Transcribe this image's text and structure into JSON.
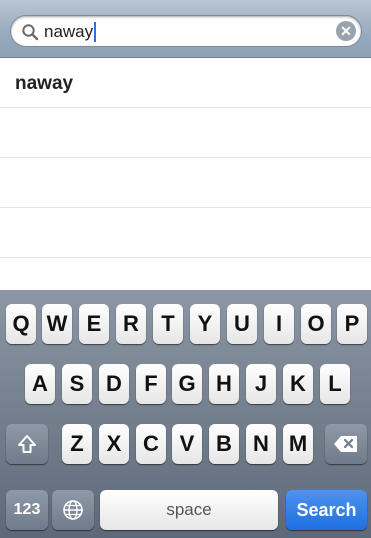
{
  "search": {
    "query": "naway"
  },
  "results": [
    {
      "label": "naway"
    },
    {
      "label": ""
    },
    {
      "label": ""
    },
    {
      "label": ""
    }
  ],
  "keyboard": {
    "row1": [
      "Q",
      "W",
      "E",
      "R",
      "T",
      "Y",
      "U",
      "I",
      "O",
      "P"
    ],
    "row2": [
      "A",
      "S",
      "D",
      "F",
      "G",
      "H",
      "J",
      "K",
      "L"
    ],
    "row3": [
      "Z",
      "X",
      "C",
      "V",
      "B",
      "N",
      "M"
    ],
    "numbers_label": "123",
    "space_label": "space",
    "search_label": "Search",
    "shift_icon": "shift-icon",
    "delete_icon": "backspace-icon",
    "globe_icon": "globe-icon"
  },
  "colors": {
    "accent": "#1f6fe0",
    "keyboard_bg": "#6f7b8a"
  }
}
